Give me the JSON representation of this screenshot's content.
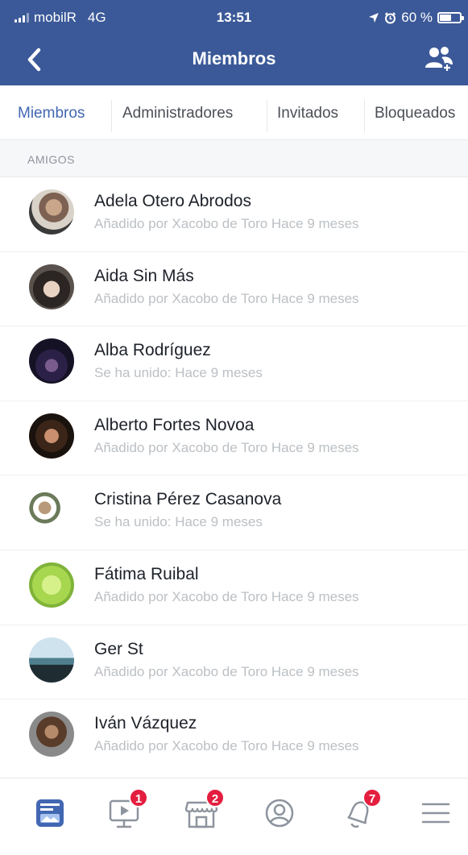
{
  "status_bar": {
    "carrier": "mobilR",
    "network": "4G",
    "time": "13:51",
    "battery_percent": "60 %",
    "battery_level": 0.6
  },
  "nav": {
    "title": "Miembros",
    "back_icon": "chevron-left-icon",
    "right_icon": "group-members-icon"
  },
  "tabs": [
    {
      "label": "Miembros",
      "active": true
    },
    {
      "label": "Administradores",
      "active": false
    },
    {
      "label": "Invitados",
      "active": false
    },
    {
      "label": "Bloqueados",
      "active": false
    }
  ],
  "section": {
    "title": "AMIGOS"
  },
  "members": [
    {
      "name": "Adela Otero Abrodos",
      "subtitle": "Añadido por Xacobo de Toro Hace 9 meses"
    },
    {
      "name": "Aida Sin Más",
      "subtitle": "Añadido por Xacobo de Toro Hace 9 meses"
    },
    {
      "name": "Alba Rodríguez",
      "subtitle": "Se ha unido: Hace 9 meses"
    },
    {
      "name": "Alberto Fortes Novoa",
      "subtitle": "Añadido por Xacobo de Toro Hace 9 meses"
    },
    {
      "name": "Cristina Pérez Casanova",
      "subtitle": "Se ha unido: Hace 9 meses"
    },
    {
      "name": "Fátima Ruibal",
      "subtitle": "Añadido por Xacobo de Toro Hace 9 meses"
    },
    {
      "name": "Ger St",
      "subtitle": "Añadido por Xacobo de Toro Hace 9 meses"
    },
    {
      "name": "Iván Vázquez",
      "subtitle": "Añadido por Xacobo de Toro Hace 9 meses"
    }
  ],
  "bottom_bar": {
    "items": [
      {
        "icon": "news-feed-icon",
        "badge": ""
      },
      {
        "icon": "watch-video-icon",
        "badge": "1"
      },
      {
        "icon": "marketplace-icon",
        "badge": "2"
      },
      {
        "icon": "profile-icon",
        "badge": ""
      },
      {
        "icon": "notifications-bell-icon",
        "badge": "7"
      },
      {
        "icon": "menu-icon",
        "badge": ""
      }
    ]
  },
  "colors": {
    "brand_blue": "#3b5998",
    "active_tab": "#4267b2",
    "badge_red": "#e41e3f"
  }
}
